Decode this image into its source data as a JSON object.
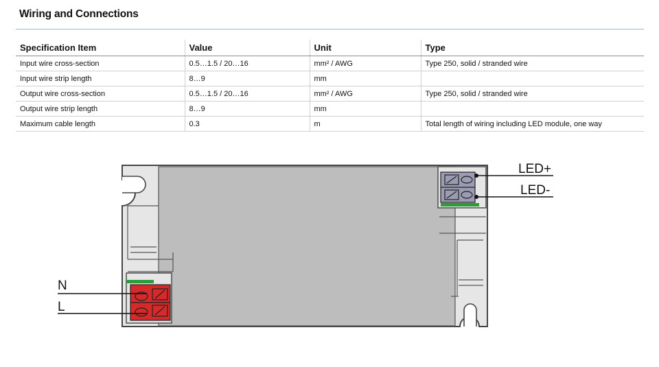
{
  "page": {
    "title": "Wiring and Connections"
  },
  "table": {
    "headers": [
      "Specification Item",
      "Value",
      "Unit",
      "Type"
    ],
    "rows": [
      [
        "Input wire cross-section",
        "0.5…1.5 / 20…16",
        "mm² / AWG",
        "Type 250, solid / stranded wire"
      ],
      [
        "Input wire strip length",
        "8…9",
        "mm",
        ""
      ],
      [
        "Output wire cross-section",
        "0.5…1.5 / 20…16",
        "mm² / AWG",
        "Type 250, solid / stranded wire"
      ],
      [
        "Output wire strip length",
        "8…9",
        "mm",
        ""
      ],
      [
        "Maximum cable length",
        "0.3",
        "m",
        "Total length of wiring including LED module, one way"
      ]
    ]
  },
  "diagram": {
    "labels": {
      "led_plus": "LED+",
      "led_minus": "LED-",
      "neutral": "N",
      "line": "L"
    },
    "colors": {
      "housing": "#bdbdbd",
      "frame": "#e6e6e6",
      "outline": "#444444",
      "input_terminal": "#d62a2a",
      "output_terminal": "#9b9bb3",
      "terminal_strip": "#2e9b3a"
    }
  }
}
